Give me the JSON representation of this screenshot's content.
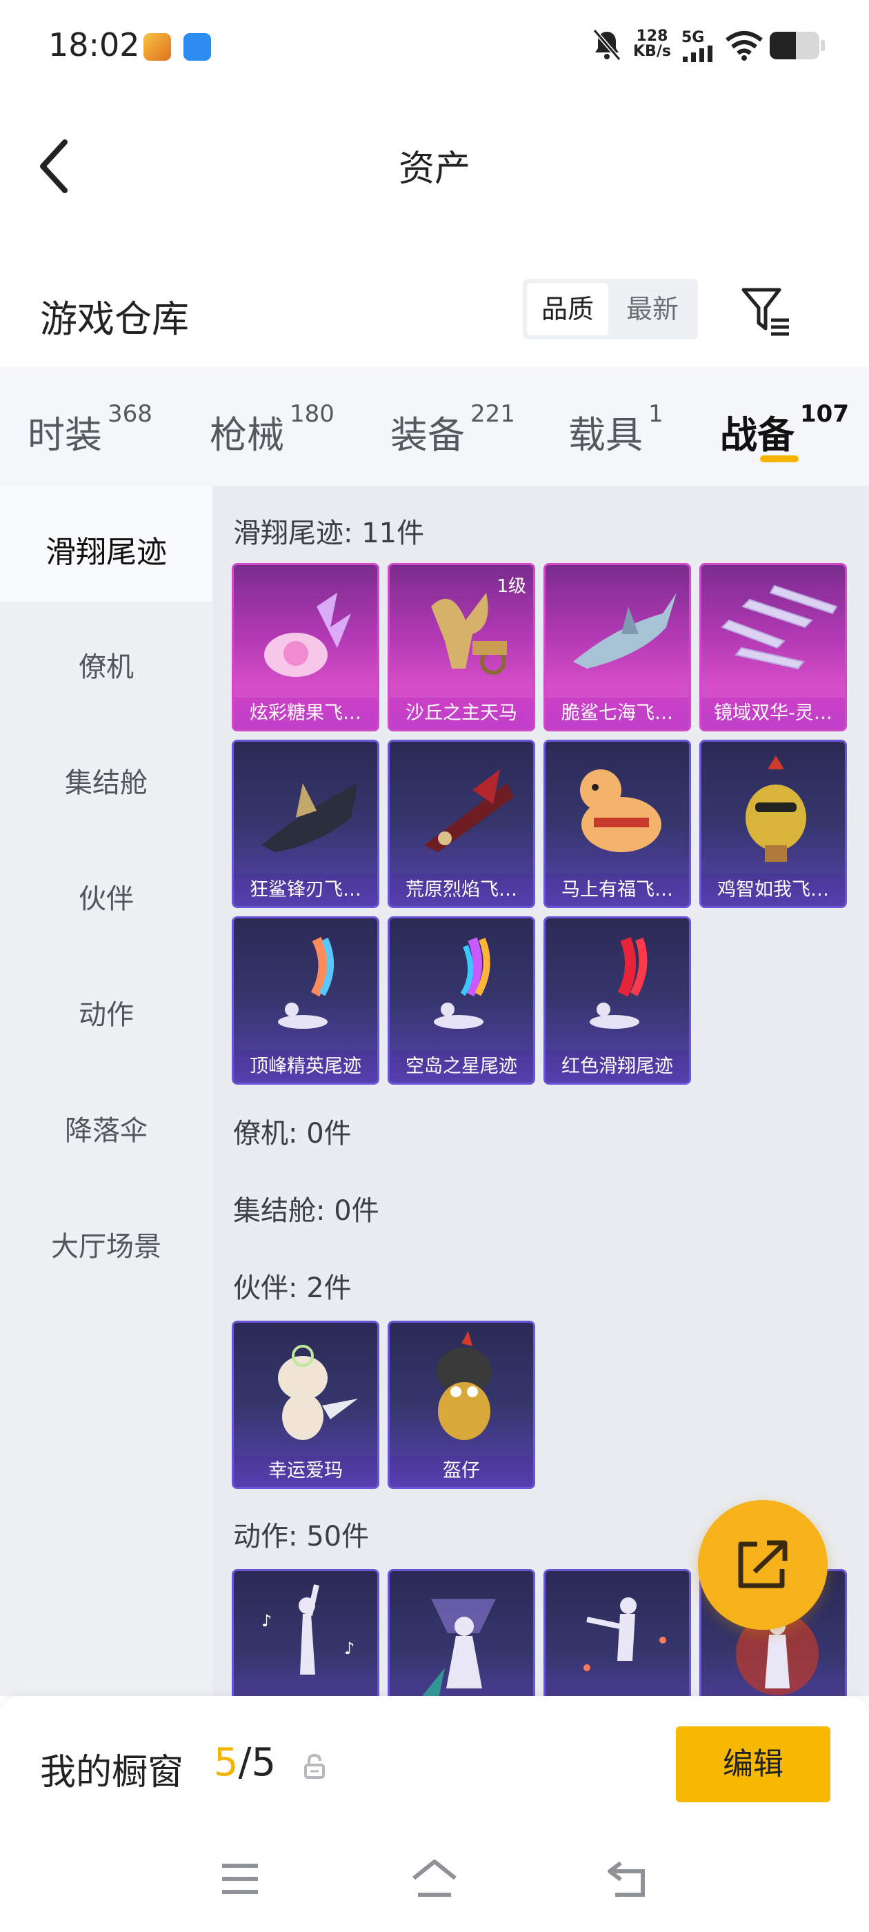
{
  "status_bar": {
    "time": "18:02",
    "net_speed_value": "128",
    "net_speed_unit": "KB/s",
    "network": "5G"
  },
  "header": {
    "title": "资产"
  },
  "warehouse": {
    "title": "游戏仓库",
    "sort_options": [
      "品质",
      "最新"
    ]
  },
  "tabs": [
    {
      "label": "时装",
      "count": "368"
    },
    {
      "label": "枪械",
      "count": "180"
    },
    {
      "label": "装备",
      "count": "221"
    },
    {
      "label": "载具",
      "count": "1"
    },
    {
      "label": "战备",
      "count": "107"
    }
  ],
  "sidenav": [
    "滑翔尾迹",
    "僚机",
    "集结舱",
    "伙伴",
    "动作",
    "降落伞",
    "大厅场景"
  ],
  "sections": {
    "glide": {
      "title": "滑翔尾迹: 11件"
    },
    "wingman": {
      "title": "僚机: 0件"
    },
    "pod": {
      "title": "集结舱: 0件"
    },
    "partner": {
      "title": "伙伴: 2件"
    },
    "emote": {
      "title": "动作: 50件"
    }
  },
  "glide_items": [
    {
      "name": "炫彩糖果飞…"
    },
    {
      "name": "沙丘之主天马",
      "level": "1级"
    },
    {
      "name": "脆鲨七海飞…"
    },
    {
      "name": "镜域双华-灵…"
    },
    {
      "name": "狂鲨锋刃飞…"
    },
    {
      "name": "荒原烈焰飞…"
    },
    {
      "name": "马上有福飞…"
    },
    {
      "name": "鸡智如我飞…"
    },
    {
      "name": "顶峰精英尾迹"
    },
    {
      "name": "空岛之星尾迹"
    },
    {
      "name": "红色滑翔尾迹"
    }
  ],
  "partner_items": [
    {
      "name": "幸运爱玛"
    },
    {
      "name": "盔仔"
    }
  ],
  "bottom": {
    "label": "我的橱窗",
    "current": "5",
    "separator": "/",
    "total": "5",
    "edit": "编辑"
  },
  "colors": {
    "accent": "#f5b400",
    "card_pink": "#c24cd1",
    "card_blue": "#4a3d95"
  }
}
